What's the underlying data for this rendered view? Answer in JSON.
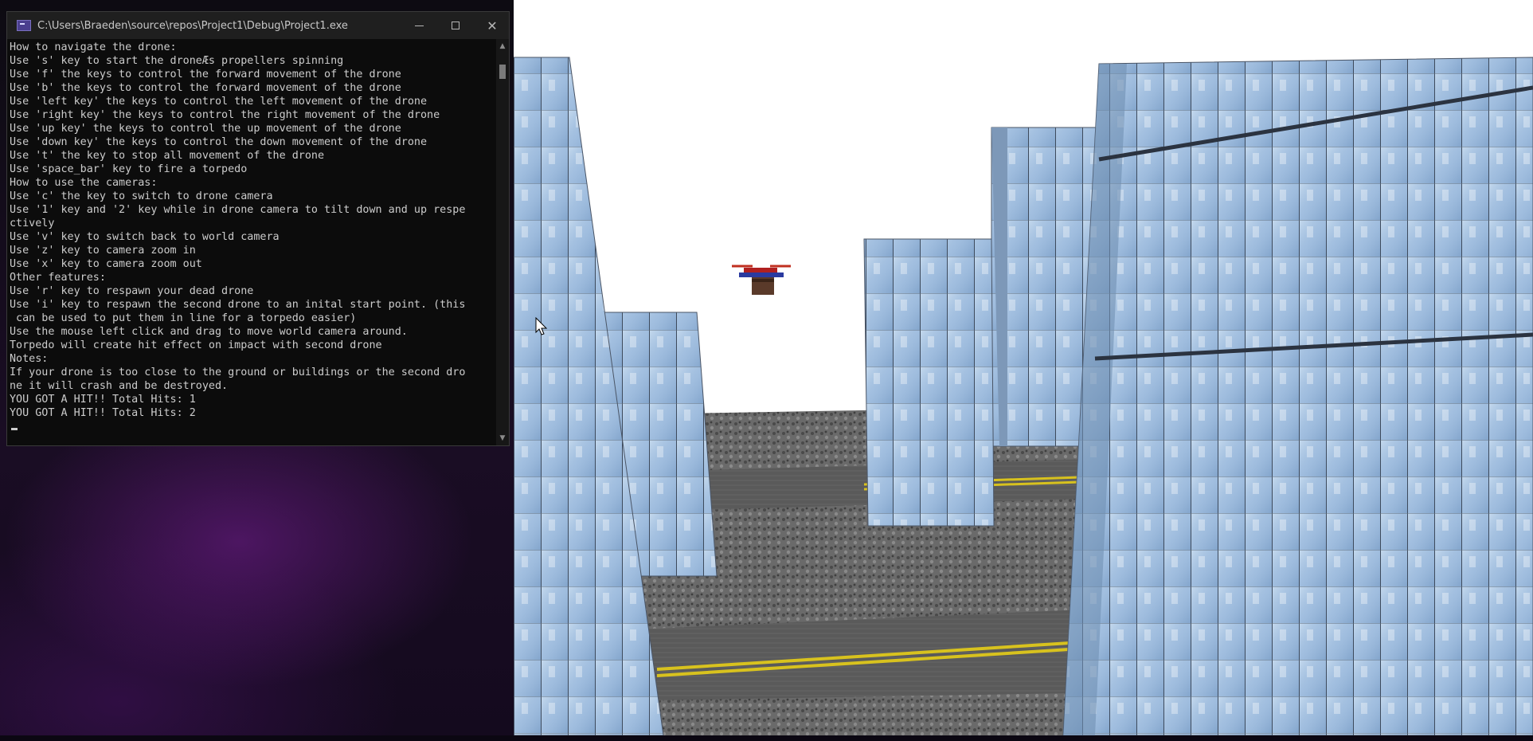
{
  "console": {
    "title": "C:\\Users\\Braeden\\source\\repos\\Project1\\Debug\\Project1.exe",
    "lines": [
      "How to navigate the drone:",
      "Use 's' key to start the droneÆs propellers spinning",
      "Use 'f' the keys to control the forward movement of the drone",
      "Use 'b' the keys to control the forward movement of the drone",
      "Use 'left key' the keys to control the left movement of the drone",
      "Use 'right key' the keys to control the right movement of the drone",
      "Use 'up key' the keys to control the up movement of the drone",
      "Use 'down key' the keys to control the down movement of the drone",
      "Use 't' the key to stop all movement of the drone",
      "Use 'space_bar' key to fire a torpedo",
      "How to use the cameras:",
      "Use 'c' the key to switch to drone camera",
      "Use '1' key and '2' key while in drone camera to tilt down and up respe",
      "ctively",
      "Use 'v' key to switch back to world camera",
      "Use 'z' key to camera zoom in",
      "Use 'x' key to camera zoom out",
      "Other features:",
      "Use 'r' key to respawn your dead drone",
      "Use 'i' key to respawn the second drone to an inital start point. (this",
      " can be used to put them in line for a torpedo easier)",
      "Use the mouse left click and drag to move world camera around.",
      "Torpedo will create hit effect on impact with second drone",
      "Notes:",
      "If your drone is too close to the ground or buildings or the second dro",
      "ne it will crash and be destroyed.",
      "YOU GOT A HIT!! Total Hits: 1",
      "YOU GOT A HIT!! Total Hits: 2"
    ],
    "controls": {
      "minimize": "minimize",
      "maximize": "maximize",
      "close": "✕"
    },
    "icons": [
      "console-app-icon",
      "minimize-icon",
      "maximize-icon",
      "close-icon",
      "scroll-up-icon",
      "scroll-down-icon",
      "mouse-pointer-icon"
    ]
  },
  "colors": {
    "console_bg": "#0c0c0c",
    "console_text": "#cccccc",
    "titlebar": "#1f1f1f",
    "sky": "#ffffff",
    "road": "#5b5b5b",
    "road_line": "#d8c21e",
    "glass": "#a9c6e6"
  }
}
